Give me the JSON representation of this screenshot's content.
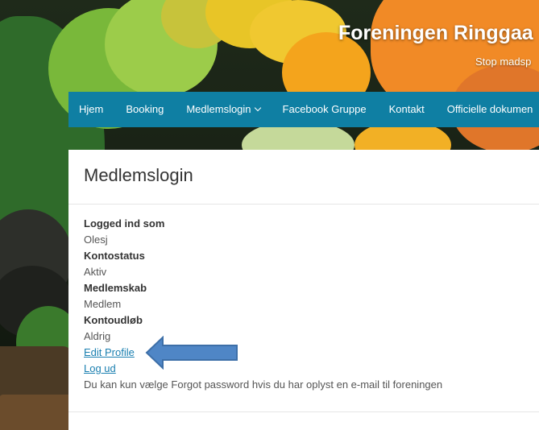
{
  "site": {
    "title": "Foreningen Ringgaa",
    "subtitle": "Stop madsp"
  },
  "nav": {
    "items": [
      {
        "label": "Hjem"
      },
      {
        "label": "Booking"
      },
      {
        "label": "Medlemslogin",
        "has_dropdown": true
      },
      {
        "label": "Facebook Gruppe"
      },
      {
        "label": "Kontakt"
      },
      {
        "label": "Officielle dokumen"
      }
    ]
  },
  "page": {
    "title": "Medlemslogin",
    "fields": [
      {
        "label": "Logged ind som",
        "value": "Olesj"
      },
      {
        "label": "Kontostatus",
        "value": "Aktiv"
      },
      {
        "label": "Medlemskab",
        "value": "Medlem"
      },
      {
        "label": "Kontoudløb",
        "value": "Aldrig"
      }
    ],
    "links": {
      "edit_profile": "Edit Profile",
      "logout": "Log ud"
    },
    "note": "Du kan kun vælge Forgot password hvis du har oplyst en e-mail til foreningen"
  },
  "colors": {
    "nav_bg": "#0f7fa3",
    "link": "#1a7fb0",
    "arrow_fill": "#4f86c6",
    "arrow_stroke": "#3d6fa8"
  },
  "icons": [
    "chevron-down-icon",
    "arrow-left-icon"
  ]
}
